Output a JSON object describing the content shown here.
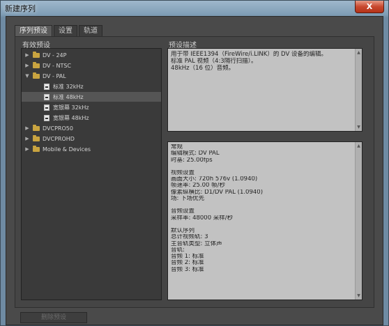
{
  "window": {
    "title": "新建序列",
    "close_label": "X"
  },
  "tabs": [
    {
      "label": "序列预设",
      "active": true
    },
    {
      "label": "设置",
      "active": false
    },
    {
      "label": "轨道",
      "active": false
    }
  ],
  "presets": {
    "label": "有效预设",
    "items": [
      {
        "label": "DV - 24P",
        "type": "folder",
        "expanded": false
      },
      {
        "label": "DV - NTSC",
        "type": "folder",
        "expanded": false
      },
      {
        "label": "DV - PAL",
        "type": "folder",
        "expanded": true
      },
      {
        "label": "标准 32kHz",
        "type": "file",
        "selected": false
      },
      {
        "label": "标准 48kHz",
        "type": "file",
        "selected": true
      },
      {
        "label": "宽银幕 32kHz",
        "type": "file",
        "selected": false
      },
      {
        "label": "宽银幕 48kHz",
        "type": "file",
        "selected": false
      },
      {
        "label": "DVCPRO50",
        "type": "folder",
        "expanded": false
      },
      {
        "label": "DVCPROHD",
        "type": "folder",
        "expanded": false
      },
      {
        "label": "Mobile & Devices",
        "type": "folder",
        "expanded": false
      }
    ]
  },
  "description": {
    "label": "预设描述",
    "lines": [
      "用于带 IEEE1394（FireWire/i.LINK）的 DV 设备的编辑。",
      "标准 PAL 视频（4:3隔行扫描）。",
      "48kHz（16 位）音频。"
    ]
  },
  "info": {
    "lines": [
      "常规",
      " 编辑模式: DV PAL",
      " 时基: 25.00fps",
      "",
      "视频设置",
      " 画面大小: 720h 576v (1.0940)",
      " 帧速率: 25.00 帧/秒",
      " 像素纵横比: D1/DV PAL (1.0940)",
      " 场: 下场优先",
      "",
      "音频设置",
      " 采样率: 48000 采样/秒",
      "",
      "默认序列",
      " 总计视频轨: 3",
      " 主音轨类型: 立体声",
      " 音轨:",
      " 音频 1: 标准",
      " 音频 2: 标准",
      " 音频 3: 标准"
    ]
  },
  "footer": {
    "delete_label": "删除预设"
  }
}
